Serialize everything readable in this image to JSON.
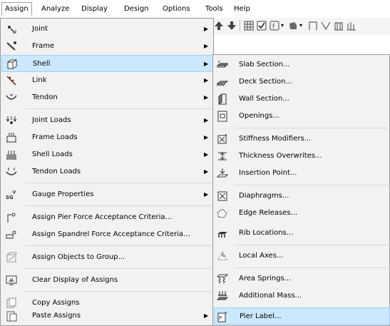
{
  "menubar": {
    "items": [
      {
        "label": "Assign"
      },
      {
        "label": "Analyze"
      },
      {
        "label": "Display"
      },
      {
        "label": "Design"
      },
      {
        "label": "Options"
      },
      {
        "label": "Tools"
      },
      {
        "label": "Help"
      }
    ]
  },
  "assign_menu": {
    "items": [
      {
        "label": "Joint",
        "icon": "joint-icon",
        "submenu": true
      },
      {
        "label": "Frame",
        "icon": "frame-icon",
        "submenu": true
      },
      {
        "label": "Shell",
        "icon": "shell-icon",
        "submenu": true,
        "highlighted": true
      },
      {
        "label": "Link",
        "icon": "link-icon",
        "submenu": true
      },
      {
        "label": "Tendon",
        "icon": "tendon-icon",
        "submenu": true
      },
      {
        "label": "Joint Loads",
        "icon": "joint-loads-icon",
        "submenu": true
      },
      {
        "label": "Frame Loads",
        "icon": "frame-loads-icon",
        "submenu": true
      },
      {
        "label": "Shell Loads",
        "icon": "shell-loads-icon",
        "submenu": true
      },
      {
        "label": "Tendon Loads",
        "icon": "tendon-loads-icon",
        "submenu": true
      },
      {
        "label": "Gauge Properties",
        "icon": "gauge-properties-icon",
        "submenu": true
      },
      {
        "label": "Assign Pier Force Acceptance Criteria...",
        "icon": "pier-force-icon",
        "submenu": false
      },
      {
        "label": "Assign Spandrel Force Acceptance Criteria...",
        "icon": "spandrel-force-icon",
        "submenu": false
      },
      {
        "label": "Assign Objects to Group...",
        "icon": "group-icon",
        "submenu": false
      },
      {
        "label": "Clear Display of Assigns",
        "icon": "clear-display-icon",
        "submenu": false
      },
      {
        "label": "Copy Assigns",
        "icon": "copy-icon",
        "submenu": false
      },
      {
        "label": "Paste Assigns",
        "icon": "paste-icon",
        "submenu": true
      }
    ]
  },
  "shell_submenu": {
    "items": [
      {
        "label": "Slab Section...",
        "icon": "slab-section-icon"
      },
      {
        "label": "Deck Section...",
        "icon": "deck-section-icon"
      },
      {
        "label": "Wall Section...",
        "icon": "wall-section-icon"
      },
      {
        "label": "Openings...",
        "icon": "openings-icon"
      },
      {
        "label": "Stiffness Modifiers...",
        "icon": "stiffness-modifiers-icon"
      },
      {
        "label": "Thickness Overwrites...",
        "icon": "thickness-overwrites-icon"
      },
      {
        "label": "Insertion Point...",
        "icon": "insertion-point-icon"
      },
      {
        "label": "Diaphragms...",
        "icon": "diaphragms-icon"
      },
      {
        "label": "Edge Releases...",
        "icon": "edge-releases-icon"
      },
      {
        "label": "Rib Locations...",
        "icon": "rib-locations-icon"
      },
      {
        "label": "Local Axes...",
        "icon": "local-axes-icon"
      },
      {
        "label": "Area Springs...",
        "icon": "area-springs-icon"
      },
      {
        "label": "Additional Mass...",
        "icon": "additional-mass-icon"
      },
      {
        "label": "Pier Label...",
        "icon": "pier-label-icon",
        "highlighted": true
      }
    ]
  },
  "colors": {
    "highlight_bg": "#cce8ff",
    "highlight_border": "#99d1ff",
    "menu_bg": "#f2f2f2",
    "menu_border": "#9a9a9a"
  }
}
